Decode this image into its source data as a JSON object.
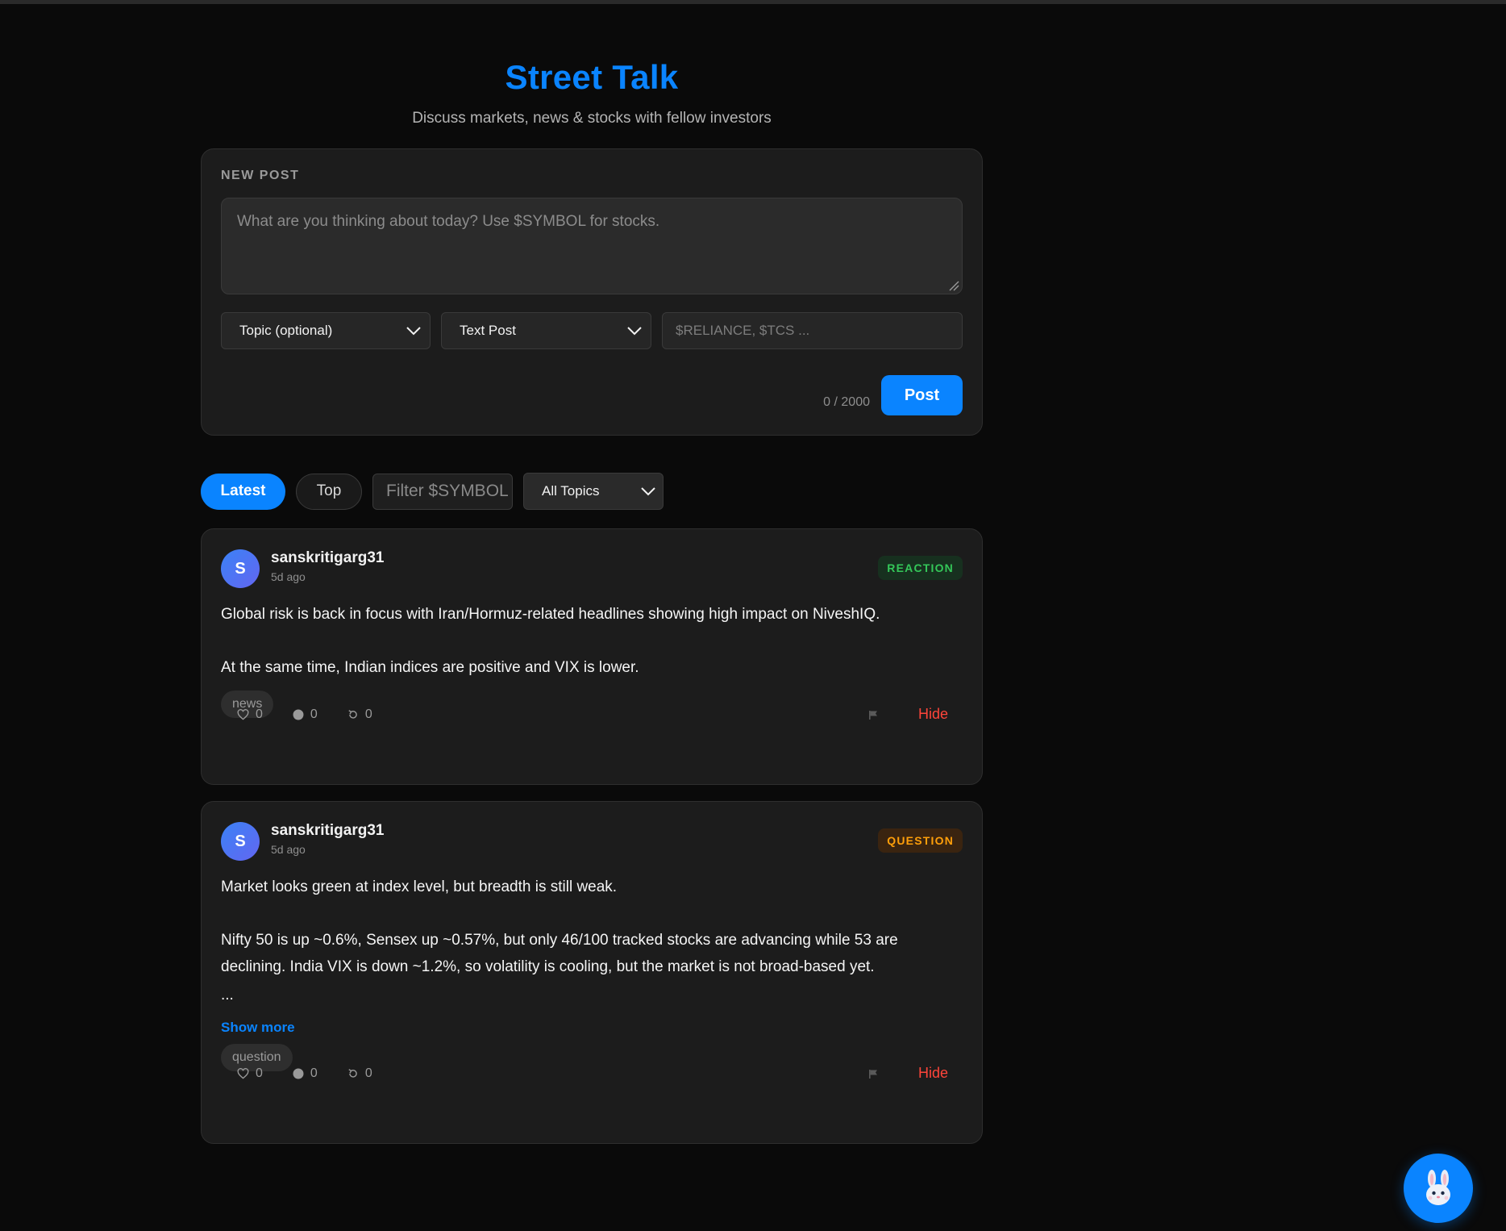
{
  "header": {
    "title": "Street Talk",
    "subtitle": "Discuss markets, news & stocks with fellow investors"
  },
  "composer": {
    "section_label": "NEW POST",
    "textarea_placeholder": "What are you thinking about today? Use $SYMBOL for stocks.",
    "topic_select": "Topic (optional)",
    "type_select": "Text Post",
    "symbols_placeholder": "$RELIANCE, $TCS ...",
    "char_count": "0 / 2000",
    "post_label": "Post"
  },
  "filters": {
    "tabs": [
      {
        "label": "Latest",
        "active": true
      },
      {
        "label": "Top",
        "active": false
      }
    ],
    "symbol_filter_placeholder": "Filter $SYMBOL",
    "topics_select": "All Topics"
  },
  "posts": [
    {
      "avatar_letter": "S",
      "username": "sanskritigarg31",
      "time": "5d ago",
      "badge": "REACTION",
      "badge_color": "#34c759",
      "paragraphs": [
        "Global risk is back in focus with Iran/Hormuz-related headlines showing high impact on NiveshIQ.",
        "At the same time, Indian indices are positive and VIX is lower."
      ],
      "tag": "news",
      "likes": "0",
      "comments": "0",
      "reposts": "0",
      "flag_icon": "flag-icon",
      "hide_label": "Hide"
    },
    {
      "avatar_letter": "S",
      "username": "sanskritigarg31",
      "time": "5d ago",
      "badge": "QUESTION",
      "badge_color": "#ff9f0a",
      "paragraphs": [
        "Market looks green at index level, but breadth is still weak.",
        "Nifty 50 is up ~0.6%, Sensex up ~0.57%, but only 46/100 tracked stocks are advancing while 53 are declining. India VIX is down ~1.2%, so volatility is cooling, but the market is not broad-based yet."
      ],
      "ellipsis": "...",
      "show_more": "Show more",
      "tag": "question",
      "likes": "0",
      "comments": "0",
      "reposts": "0",
      "flag_icon": "flag-icon",
      "hide_label": "Hide"
    }
  ],
  "fab": {
    "icon": "bunny-mascot-icon"
  },
  "colors": {
    "accent": "#0a84ff",
    "background": "#0a0a0a",
    "card": "#1c1c1c",
    "danger": "#ff453a"
  }
}
